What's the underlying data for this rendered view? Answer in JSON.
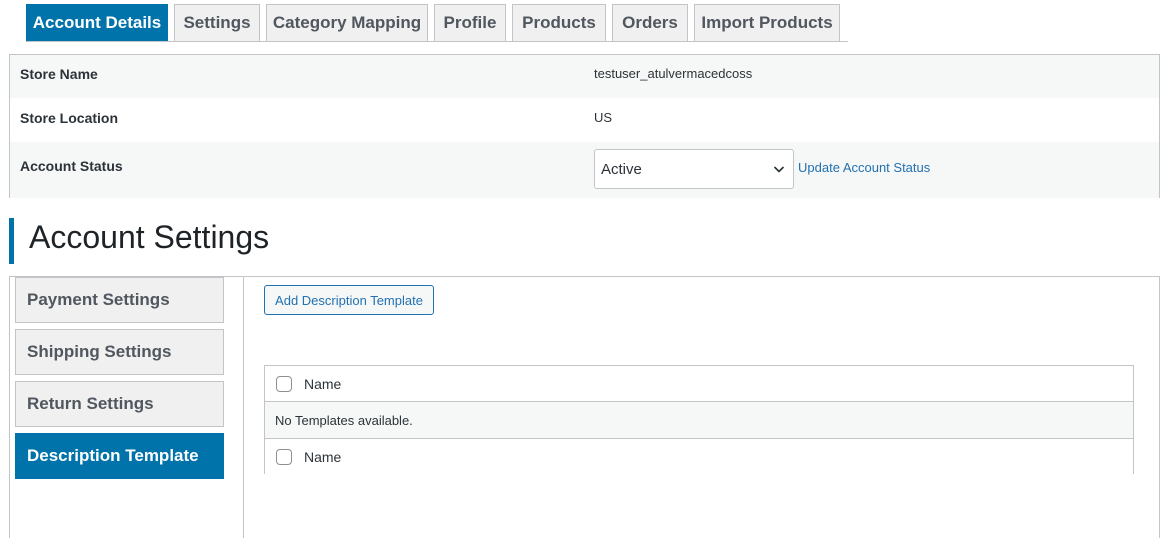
{
  "tabs": [
    {
      "label": "Account Details",
      "active": true
    },
    {
      "label": "Settings"
    },
    {
      "label": "Category Mapping"
    },
    {
      "label": "Profile"
    },
    {
      "label": "Products"
    },
    {
      "label": "Orders"
    },
    {
      "label": "Import Products"
    }
  ],
  "store": {
    "name_label": "Store Name",
    "name_value": "testuser_atulvermacedcoss",
    "location_label": "Store Location",
    "location_value": "US",
    "status_label": "Account Status",
    "status_selected": "Active",
    "status_select_icon": "chevron-down-icon",
    "update_link": "Update Account Status"
  },
  "account_settings": {
    "title": "Account Settings",
    "menu": [
      {
        "label": "Payment Settings"
      },
      {
        "label": "Shipping Settings"
      },
      {
        "label": "Return Settings"
      },
      {
        "label": "Description Template",
        "active": true
      }
    ],
    "add_button": "Add Description Template",
    "table": {
      "column_name": "Name",
      "empty_message": "No Templates available.",
      "footer_column_name": "Name"
    }
  },
  "colors": {
    "accent": "#0073aa",
    "link": "#2271b1",
    "border": "#c3c4c7",
    "row_alt": "#f6f7f7"
  }
}
